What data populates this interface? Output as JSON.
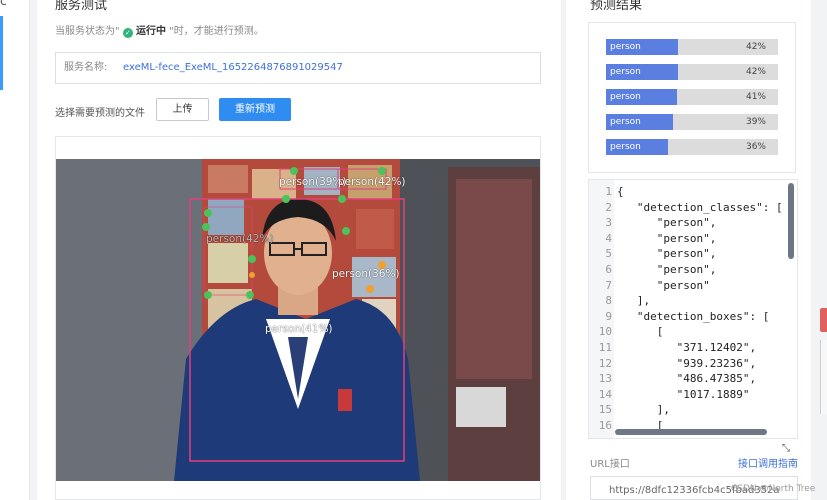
{
  "left_nav": {
    "cut_char": "c"
  },
  "main": {
    "title": "服务测试",
    "hint_prefix": "当服务状态为\"",
    "hint_status": "运行中",
    "hint_suffix": "\"时，才能进行预测。",
    "service_name_label": "服务名称:",
    "service_name_value": "exeML-fece_ExeML_1652264876891029547",
    "file_label": "选择需要预测的文件",
    "upload_button": "上传",
    "repredict_button": "重新预测",
    "detections": [
      {
        "label": "person(39%)"
      },
      {
        "label": "person(42%)"
      },
      {
        "label": "person(42%)"
      },
      {
        "label": "person(36%)"
      },
      {
        "label": "person(41%)"
      }
    ]
  },
  "right": {
    "title": "预测结果",
    "results": [
      {
        "class": "person",
        "percent": "42%",
        "fill": 0.42
      },
      {
        "class": "person",
        "percent": "42%",
        "fill": 0.42
      },
      {
        "class": "person",
        "percent": "41%",
        "fill": 0.41
      },
      {
        "class": "person",
        "percent": "39%",
        "fill": 0.39
      },
      {
        "class": "person",
        "percent": "36%",
        "fill": 0.36
      }
    ],
    "code_lines": [
      {
        "n": "1",
        "t": "{"
      },
      {
        "n": "2",
        "t": "   \"detection_classes\": ["
      },
      {
        "n": "3",
        "t": "      \"person\","
      },
      {
        "n": "4",
        "t": "      \"person\","
      },
      {
        "n": "5",
        "t": "      \"person\","
      },
      {
        "n": "6",
        "t": "      \"person\","
      },
      {
        "n": "7",
        "t": "      \"person\""
      },
      {
        "n": "8",
        "t": "   ],"
      },
      {
        "n": "9",
        "t": "   \"detection_boxes\": ["
      },
      {
        "n": "10",
        "t": "      ["
      },
      {
        "n": "11",
        "t": "         \"371.12402\","
      },
      {
        "n": "12",
        "t": "         \"939.23236\","
      },
      {
        "n": "13",
        "t": "         \"486.47385\","
      },
      {
        "n": "14",
        "t": "         \"1017.1889\""
      },
      {
        "n": "15",
        "t": "      ],"
      },
      {
        "n": "16",
        "t": "      ["
      }
    ],
    "url_label": "URL接口",
    "api_guide_link": "接口调用指南",
    "url_value": "https://8dfc12336fcb4c5fbad352a"
  },
  "watermark": "CSDN @North Tree",
  "colors": {
    "accent": "#2f8cf0",
    "bar_fill": "#5b7fe0",
    "status_ok": "#2fb47c",
    "box_pink": "#e0407a"
  },
  "icons": [
    "check-circle-icon",
    "resize-handle-icon"
  ]
}
